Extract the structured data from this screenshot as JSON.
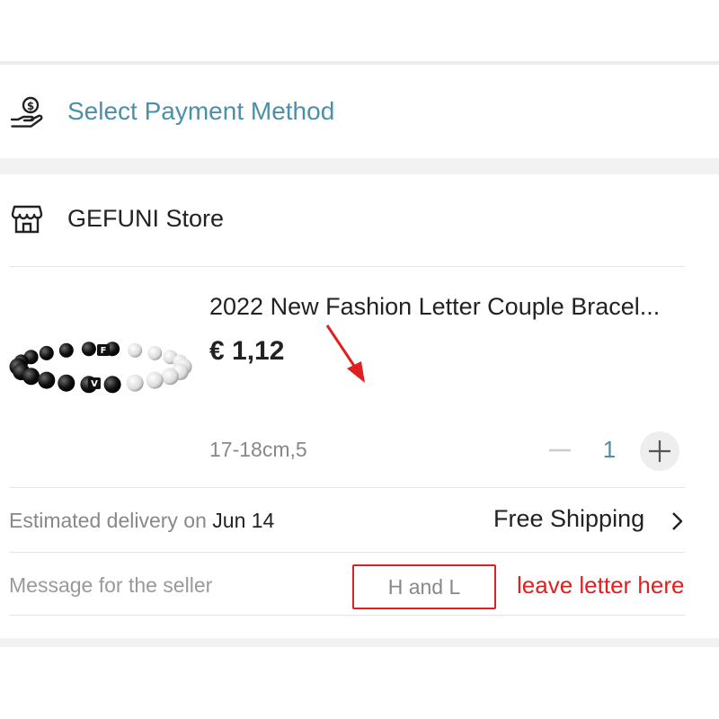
{
  "payment": {
    "label": "Select Payment Method",
    "icon": "hand-coin-icon"
  },
  "store": {
    "name": "GEFUNI Store",
    "icon": "storefront-icon"
  },
  "product": {
    "title": "2022 New Fashion Letter Couple Bracel...",
    "price": "€ 1,12",
    "variant": "17-18cm,5",
    "quantity": "1",
    "image": "bead-bracelet-image",
    "bead_letters": [
      "F",
      "V"
    ]
  },
  "delivery": {
    "label": "Estimated delivery on",
    "date": "Jun 14"
  },
  "shipping": {
    "label": "Free Shipping"
  },
  "message": {
    "label": "Message for the seller",
    "value": "H and L"
  },
  "annotation": {
    "text": "leave letter here",
    "color": "#e02020"
  },
  "colors": {
    "accent": "#4b8faa",
    "annotation": "#e02020",
    "band": "#f2f2f2"
  }
}
